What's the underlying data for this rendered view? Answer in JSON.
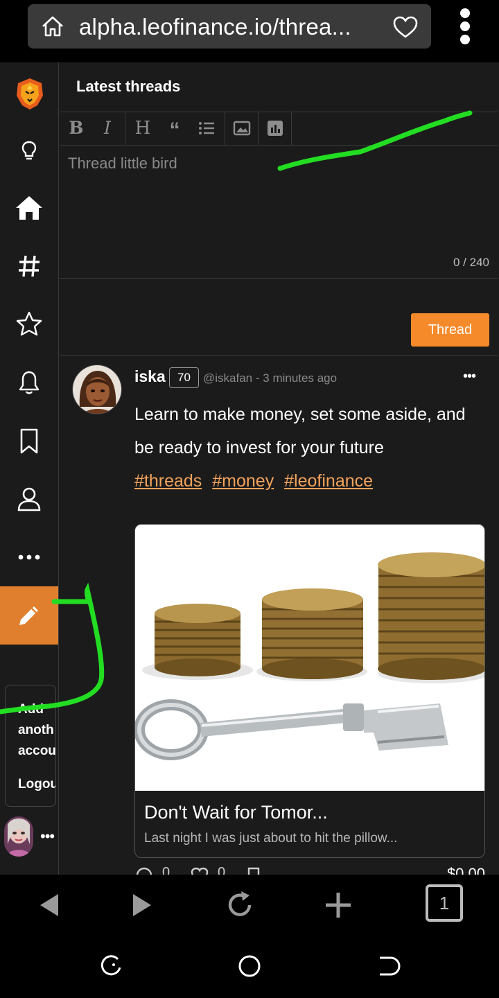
{
  "browser": {
    "url": "alpha.leofinance.io/threa...",
    "tab_count": "1"
  },
  "header": {
    "title": "Latest threads"
  },
  "editor": {
    "placeholder": "Thread little bird",
    "char_count": "0 / 240",
    "submit_label": "Thread"
  },
  "sidebar": {
    "items": [
      "lightbulb-icon",
      "home-icon",
      "hashtag-icon",
      "star-icon",
      "bell-icon",
      "bookmark-icon",
      "profile-icon",
      "more-icon"
    ],
    "compose_icon": "pencil-icon",
    "account_menu": {
      "add_label": "Add another account",
      "add_line1": "Add",
      "add_line2": "anoth",
      "add_line3": "accou",
      "logout_label": "Logou"
    },
    "more_label": "•••"
  },
  "post": {
    "author": "iska",
    "reputation": "70",
    "handle": "@iskafan",
    "separator": "-",
    "time": "3 minutes ago",
    "more_label": "•••",
    "body": "Learn to make money, set some aside, and be ready to invest for your future",
    "tags": [
      "#threads",
      "#money",
      "#leofinance"
    ],
    "card": {
      "title": "Don't Wait for Tomor...",
      "description": "Last night I was just about to hit the pillow..."
    },
    "actions": {
      "comments": "0",
      "likes": "0",
      "payout": "$0.00"
    }
  },
  "colors": {
    "accent": "#f58a2a",
    "compose_bg": "#e0802e",
    "tag": "#f5a35a",
    "background": "#1b1b1c",
    "annotation": "#22dd22"
  }
}
